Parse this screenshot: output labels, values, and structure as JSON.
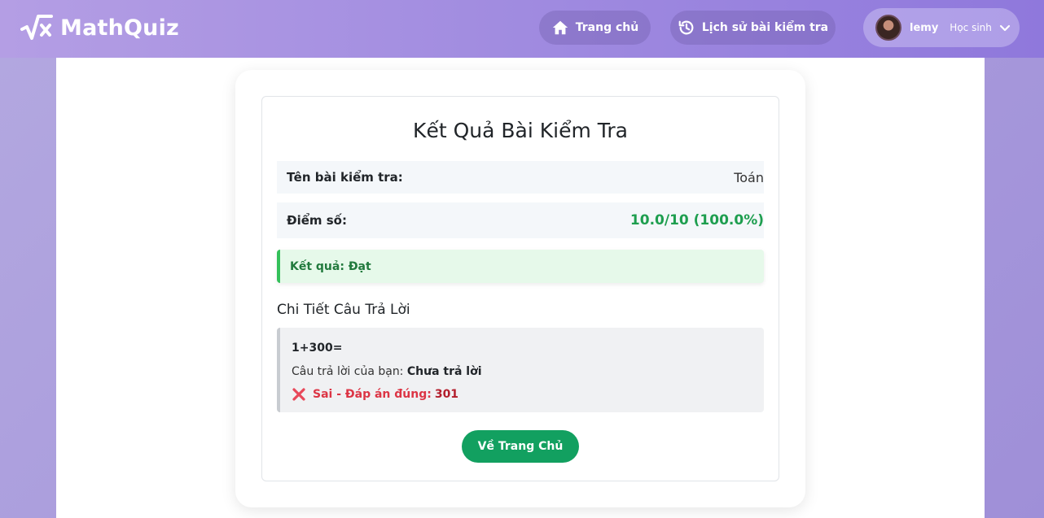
{
  "brand": {
    "name": "MathQuiz",
    "icon": "sqrt-x-icon"
  },
  "nav": {
    "home_label": "Trang chủ",
    "history_label": "Lịch sử bài kiểm tra"
  },
  "user": {
    "name": "lemy",
    "role": "Học sinh"
  },
  "result": {
    "title": "Kết Quả Bài Kiểm Tra",
    "test_name_label": "Tên bài kiểm tra:",
    "test_name_value": "Toán",
    "score_label": "Điểm số:",
    "score_value": "10.0/10 (100.0%)",
    "outcome": "Kết quả: Đạt",
    "details_heading": "Chi Tiết Câu Trả Lời",
    "question": "1+300=",
    "your_answer_label": "Câu trả lời của bạn:",
    "your_answer_value": "Chưa trả lời",
    "verdict_label": "Sai - Đáp án đúng:",
    "correct_answer": "301",
    "back_button": "Về Trang Chủ"
  },
  "colors": {
    "accent_green": "#12a060",
    "score_green": "#1e9e4f",
    "error_red": "#dc3545",
    "navbar_start": "#b49ee4",
    "navbar_end": "#8f78dc"
  }
}
